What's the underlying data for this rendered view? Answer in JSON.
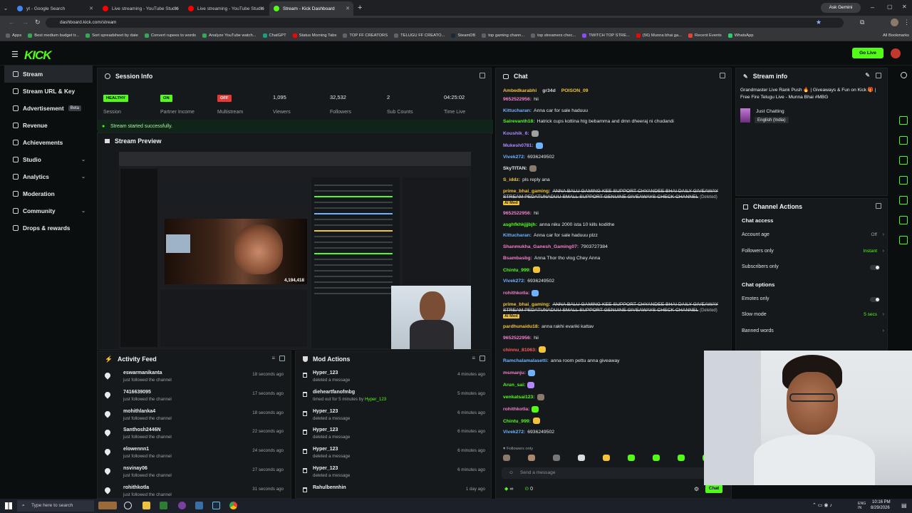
{
  "browser": {
    "tabs": [
      {
        "title": "yt - Google Search",
        "favicon_color": "#4285f4"
      },
      {
        "title": "Live streaming - YouTube Studio",
        "favicon_color": "#ff0000"
      },
      {
        "title": "Live streaming - YouTube Studio",
        "favicon_color": "#ff0000"
      },
      {
        "title": "Stream - Kick Dashboard",
        "favicon_color": "#53fc18"
      }
    ],
    "new_tab": "+",
    "ask_gemini": "Ask Gemini",
    "url": "dashboard.kick.com/stream",
    "bookmarks": [
      "Apps",
      "Best medium budget tr...",
      "Sort spreadsheet by date",
      "Convert rupees to words",
      "Analyze YouTube watch...",
      "ChatGPT",
      "Status Morning Tabs",
      "TOP FF CREATORS",
      "TELUGU FF CREATO...",
      "SteamDB",
      "top gaming chann...",
      "top streamers chec...",
      "TWITCH TOP STRE...",
      "(56) Munna bhai ga...",
      "Recent Events",
      "WhatsApp"
    ],
    "all_bookmarks": "All Bookmarks"
  },
  "header": {
    "logo": "KICK",
    "go_live": "Go Live"
  },
  "sidebar": {
    "items": [
      {
        "label": "Stream",
        "active": true
      },
      {
        "label": "Stream URL & Key"
      },
      {
        "label": "Advertisement",
        "badge": "Beta"
      },
      {
        "label": "Revenue"
      },
      {
        "label": "Achievements"
      },
      {
        "label": "Studio",
        "chevron": true
      },
      {
        "label": "Analytics",
        "chevron": true
      },
      {
        "label": "Moderation"
      },
      {
        "label": "Community",
        "chevron": true
      },
      {
        "label": "Drops & rewards"
      }
    ]
  },
  "session": {
    "title": "Session Info",
    "stats": [
      {
        "value": "HEALTHY",
        "label": "Session",
        "badge": "green"
      },
      {
        "value": "ON",
        "label": "Partner Income",
        "badge": "green"
      },
      {
        "value": "OFF",
        "label": "Multistream",
        "badge": "red"
      },
      {
        "value": "1,095",
        "label": "Viewers"
      },
      {
        "value": "32,532",
        "label": "Followers"
      },
      {
        "value": "2",
        "label": "Sub Counts"
      },
      {
        "value": "04:25:02",
        "label": "Time Live"
      }
    ],
    "started": "Stream started successfully."
  },
  "preview": {
    "title": "Stream Preview",
    "viewers_overlay": "4,194,418"
  },
  "activity": {
    "title": "Activity Feed",
    "rows": [
      {
        "name": "eswarmanikanta",
        "action": "just followed the channel",
        "time": "18 seconds ago"
      },
      {
        "name": "7416639095",
        "action": "just followed the channel",
        "time": "17 seconds ago"
      },
      {
        "name": "mohithlanka4",
        "action": "just followed the channel",
        "time": "18 seconds ago"
      },
      {
        "name": "Santhosh2446N",
        "action": "just followed the channel",
        "time": "22 seconds ago"
      },
      {
        "name": "elowennn1",
        "action": "just followed the channel",
        "time": "24 seconds ago"
      },
      {
        "name": "nsvinay06",
        "action": "just followed the channel",
        "time": "27 seconds ago"
      },
      {
        "name": "rohithkotla",
        "action": "just followed the channel",
        "time": "31 seconds ago"
      }
    ]
  },
  "mod": {
    "title": "Mod Actions",
    "rows": [
      {
        "name": "Hyper_123",
        "action": "deleted a message",
        "time": "4 minutes ago"
      },
      {
        "name": "dieheartfanofmbg",
        "action": "timed out for 5 minutes by",
        "by": "Hyper_123",
        "time": "5 minutes ago"
      },
      {
        "name": "Hyper_123",
        "action": "deleted a message",
        "time": "6 minutes ago"
      },
      {
        "name": "Hyper_123",
        "action": "deleted a message",
        "time": "6 minutes ago"
      },
      {
        "name": "Hyper_123",
        "action": "deleted a message",
        "time": "6 minutes ago"
      },
      {
        "name": "Hyper_123",
        "action": "deleted a message",
        "time": "6 minutes ago"
      },
      {
        "name": "Rahulbennhin",
        "action": "",
        "time": "1 day ago"
      }
    ]
  },
  "chat": {
    "title": "Chat",
    "pinned": [
      "Ambedkarabhi",
      "gr34d",
      "POISON_09"
    ],
    "messages": [
      {
        "user": "9652522956",
        "text": "hii",
        "color": "#f37ec9"
      },
      {
        "user": "Kittucharan",
        "text": "Anna car for sale haduuu",
        "color": "#6fb3ff"
      },
      {
        "user": "Sairevanth18",
        "text": "Hatrick cups kottina htg bebamma and dmn dheeraj ni chudandi",
        "color": "#53fc18"
      },
      {
        "user": "Koushik_6",
        "text": "",
        "color": "#b388ff",
        "emote": true
      },
      {
        "user": "Mukesh0781",
        "text": "",
        "color": "#b388ff",
        "emote": true
      },
      {
        "user": "Vivek272",
        "text": "6936249502",
        "color": "#6fb3ff"
      },
      {
        "user": "SkyTITAN",
        "text": "",
        "color": "#e8eaeb",
        "emote": true
      },
      {
        "user": "S_iddz",
        "text": "pls reply ana",
        "color": "#f3c43b"
      },
      {
        "user": "prime_bhai_gaming",
        "text": "ANNA BALU GAMING KEE SUPPORT CHYANDEE BHAI DAILY GIVEAWAY STREAM PEDATUNADUU SMALL SUPPORT GENUINE GIVEAWAYS CHECK CHANNEL",
        "color": "#f3c43b",
        "deleted": true
      },
      {
        "user": "9652522956",
        "text": "hii",
        "color": "#f37ec9"
      },
      {
        "user": "asghfkhkjjjbjh",
        "text": "anna niku 2000 ista 10 kills kodithe",
        "color": "#53fc18"
      },
      {
        "user": "Kittucharan",
        "text": "Anna car for sale haduuu plzz",
        "color": "#6fb3ff"
      },
      {
        "user": "Shanmukha_Ganesh_Gaming07",
        "text": "7903727384",
        "color": "#f37ec9"
      },
      {
        "user": "Bsambasbg",
        "text": "Anna Thor tho vlog Chey Anna",
        "color": "#f37ec9"
      },
      {
        "user": "Chintu_999",
        "text": "",
        "color": "#53fc18",
        "emote": true
      },
      {
        "user": "Vivek272",
        "text": "6936249502",
        "color": "#6fb3ff"
      },
      {
        "user": "rohithkotla",
        "text": "",
        "color": "#f37ec9",
        "emote": true
      },
      {
        "user": "prime_bhai_gaming",
        "text": "ANNA BALU GAMING KEE SUPPORT CHYANDEE BHAI DAILY GIVEAWAY STREAM PEDATUNADUU SMALL SUPPORT GENUINE GIVEAWAYS CHECK CHANNEL",
        "color": "#f3c43b",
        "deleted": true
      },
      {
        "user": "pardhunaidu18",
        "text": "anna rakhi evariki kattav",
        "color": "#f3c43b"
      },
      {
        "user": "9652522956",
        "text": "hii",
        "color": "#f37ec9"
      },
      {
        "user": "chinnu_81063",
        "text": "",
        "color": "#ff5c5c",
        "emote": true
      },
      {
        "user": "Ramchalamalasetti",
        "text": "anna room pettu anna giveaway",
        "color": "#6fb3ff"
      },
      {
        "user": "msmanju",
        "text": "",
        "color": "#f37ec9",
        "emote": true
      },
      {
        "user": "Arun_sai",
        "text": "",
        "color": "#53fc18",
        "emote": true
      },
      {
        "user": "venkatsai123",
        "text": "",
        "color": "#53fc18",
        "emote": true
      },
      {
        "user": "rohithkotla",
        "text": "",
        "color": "#f37ec9",
        "emote": true
      },
      {
        "user": "Chintu_999",
        "text": "",
        "color": "#53fc18",
        "emote": true
      },
      {
        "user": "Vivek272",
        "text": "6936249502",
        "color": "#6fb3ff"
      }
    ],
    "deleted_tag": "(Deleted)",
    "ai_mod": "AI Mod",
    "followers_only": "Followers only",
    "placeholder": "Send a message",
    "count_infinity": "∞",
    "count_zero": "0",
    "send": "Chat"
  },
  "stream_info": {
    "title": "Stream info",
    "stream_title": "Grandmaster Live Rank Push 🔥 | Giveaways & Fun on Kick 🎁 | Free Fire Telugu Live - Munna Bhai #MBG",
    "category": "Just Chatting",
    "language": "English (India)"
  },
  "channel_actions": {
    "title": "Channel Actions",
    "chat_access": "Chat access",
    "account_age": "Account age",
    "account_age_val": "Off",
    "followers_only": "Followers only",
    "followers_only_val": "Instant",
    "subscribers_only": "Subscribers only",
    "chat_options": "Chat options",
    "emotes_only": "Emotes only",
    "slow_mode": "Slow mode",
    "slow_mode_val": "5 secs",
    "banned_words": "Banned words"
  },
  "taskbar": {
    "search": "Type here to search",
    "lang": "ENG IN",
    "time": "10:16 PM",
    "date": "8/29/2026"
  },
  "colors": {
    "accent": "#53fc18",
    "panel": "#16191c",
    "bg": "#0b0e0f"
  }
}
